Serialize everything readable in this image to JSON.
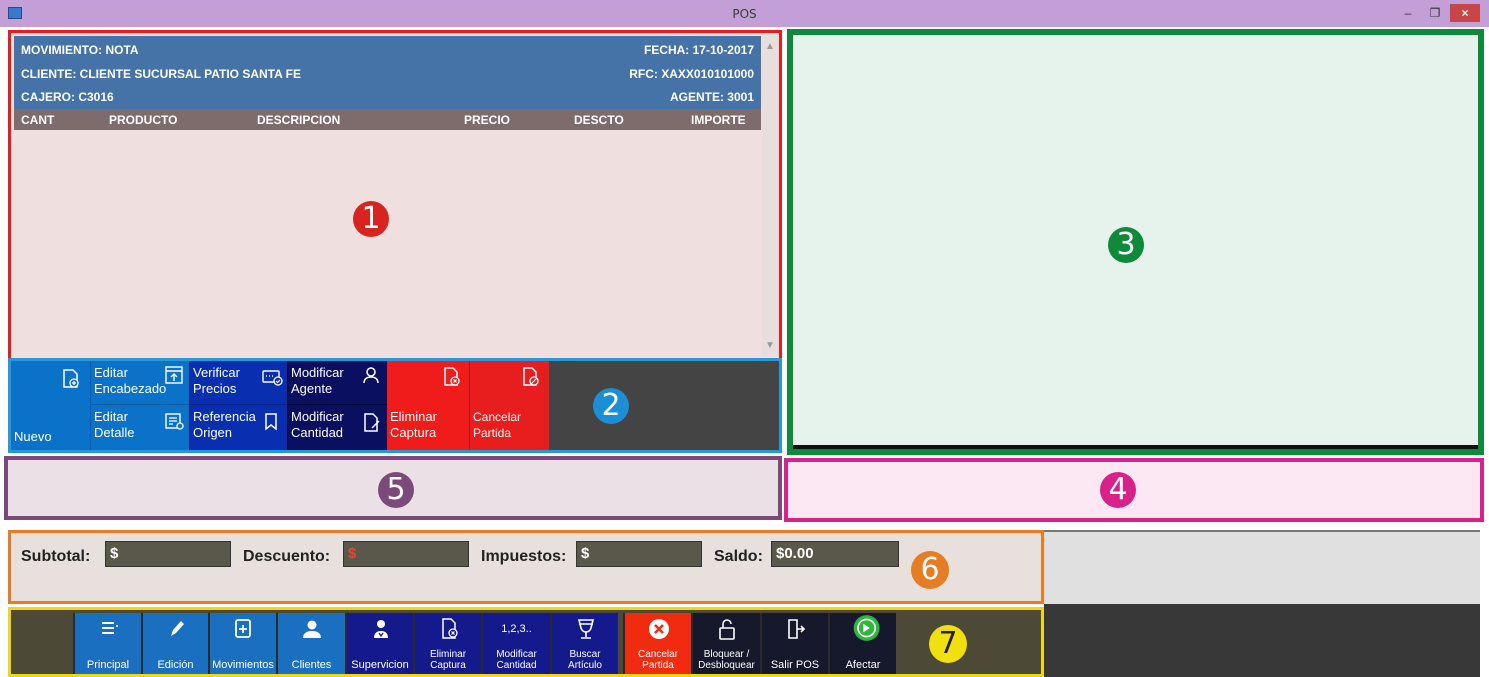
{
  "window": {
    "title": "POS",
    "minimize": "–",
    "restore": "❐",
    "close": "×"
  },
  "regions": {
    "r1": {
      "badge": "1",
      "color": "#d8241f"
    },
    "r2": {
      "badge": "2",
      "color": "#1a8fd6"
    },
    "r3": {
      "badge": "3",
      "color": "#0e8a3a"
    },
    "r4": {
      "badge": "4",
      "color": "#d8228a"
    },
    "r5": {
      "badge": "5",
      "color": "#7c4a7a"
    },
    "r6": {
      "badge": "6",
      "color": "#e67d25"
    },
    "r7": {
      "badge": "7",
      "color": "#f0e010"
    }
  },
  "header": {
    "movimiento": "MOVIMIENTO: NOTA",
    "fecha": "FECHA: 17-10-2017",
    "cliente": "CLIENTE: CLIENTE SUCURSAL PATIO SANTA FE",
    "rfc": "RFC: XAXX010101000",
    "cajero": "CAJERO: C3016",
    "agente": "AGENTE: 3001"
  },
  "columns": [
    "CANT",
    "PRODUCTO",
    "DESCRIPCION",
    "PRECIO",
    "DESCTO",
    "IMPORTE"
  ],
  "actions": {
    "nuevo": "Nuevo",
    "editar_encabezado": [
      "Editar",
      "Encabezado"
    ],
    "editar_detalle": [
      "Editar",
      "Detalle"
    ],
    "verificar_precios": [
      "Verificar",
      "Precios"
    ],
    "referencia_origen": [
      "Referencia",
      "Origen"
    ],
    "modificar_agente": [
      "Modificar",
      "Agente"
    ],
    "modificar_cantidad": [
      "Modificar",
      "Cantidad"
    ],
    "eliminar_captura": [
      "Eliminar",
      "Captura"
    ],
    "cancelar_partida": [
      "Cancelar",
      "Partida"
    ]
  },
  "totals": {
    "subtotal_label": "Subtotal:",
    "subtotal_value": "$",
    "descuento_label": "Descuento:",
    "descuento_value": "$",
    "impuestos_label": "Impuestos:",
    "impuestos_value": "$",
    "saldo_label": "Saldo:",
    "saldo_value": "$0.00"
  },
  "toolbar": {
    "principal": "Principal",
    "edicion": "Edición",
    "movimientos": "Movimientos",
    "clientes": "Clientes",
    "supervicion": "Supervicion",
    "eliminar_captura": [
      "Eliminar",
      "Captura"
    ],
    "modificar_cantidad_top": "1,2,3..",
    "modificar_cantidad": [
      "Modificar",
      "Cantidad"
    ],
    "buscar_articulo": [
      "Buscar",
      "Artículo"
    ],
    "cancelar_partida": [
      "Cancelar",
      "Partida"
    ],
    "bloquear": [
      "Bloquear /",
      "Desbloquear"
    ],
    "salir_pos": "Salir POS",
    "afectar": "Afectar"
  }
}
